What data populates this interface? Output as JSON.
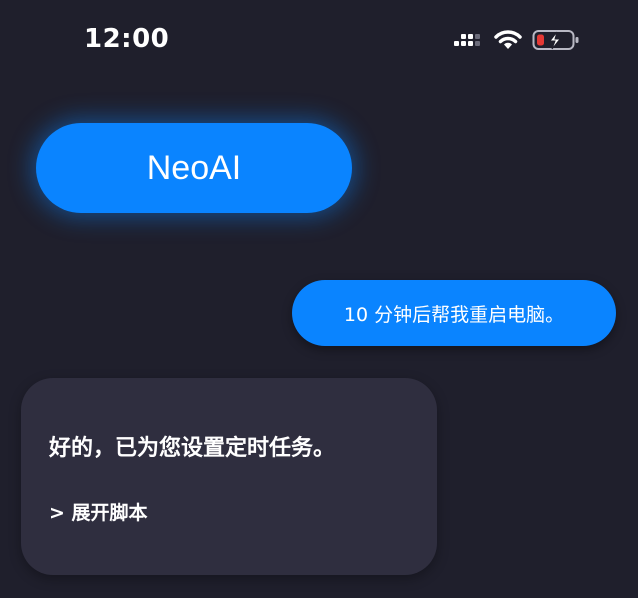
{
  "status_bar": {
    "time": "12:00",
    "icons": [
      "signal-icon",
      "wifi-icon",
      "battery-charging-icon"
    ],
    "battery_color": "#e53935"
  },
  "app": {
    "title": "NeoAI",
    "accent_color": "#0a84ff"
  },
  "messages": {
    "user": {
      "text": "10 分钟后帮我重启电脑。"
    },
    "assistant": {
      "text": "好的，已为您设置定时任务。",
      "expand_label": "> 展开脚本"
    }
  }
}
